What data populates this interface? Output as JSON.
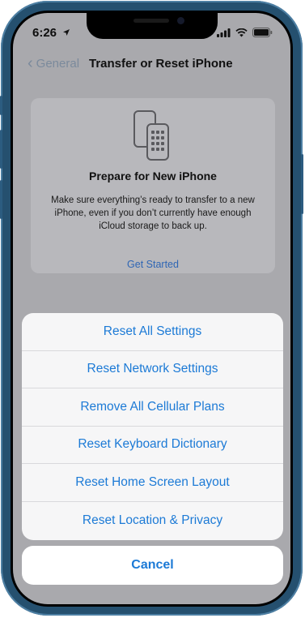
{
  "status_bar": {
    "time": "6:26",
    "location_icon": "location-arrow-icon",
    "signal_icon": "signal-bars-icon",
    "wifi_icon": "wifi-icon",
    "battery_icon": "battery-icon"
  },
  "nav": {
    "back_label": "General",
    "title": "Transfer or Reset iPhone"
  },
  "prepare_card": {
    "icon": "phone-transfer-icon",
    "title": "Prepare for New iPhone",
    "description": "Make sure everything’s ready to transfer to a new iPhone, even if you don’t currently have enough iCloud storage to back up.",
    "action_label": "Get Started"
  },
  "action_sheet": {
    "items": [
      {
        "label": "Reset All Settings"
      },
      {
        "label": "Reset Network Settings"
      },
      {
        "label": "Remove All Cellular Plans"
      },
      {
        "label": "Reset Keyboard Dictionary"
      },
      {
        "label": "Reset Home Screen Layout"
      },
      {
        "label": "Reset Location & Privacy"
      }
    ],
    "cancel_label": "Cancel"
  },
  "colors": {
    "accent": "#1c7ad6",
    "frame": "#25506f",
    "dim_background": "#a9a9ad"
  }
}
